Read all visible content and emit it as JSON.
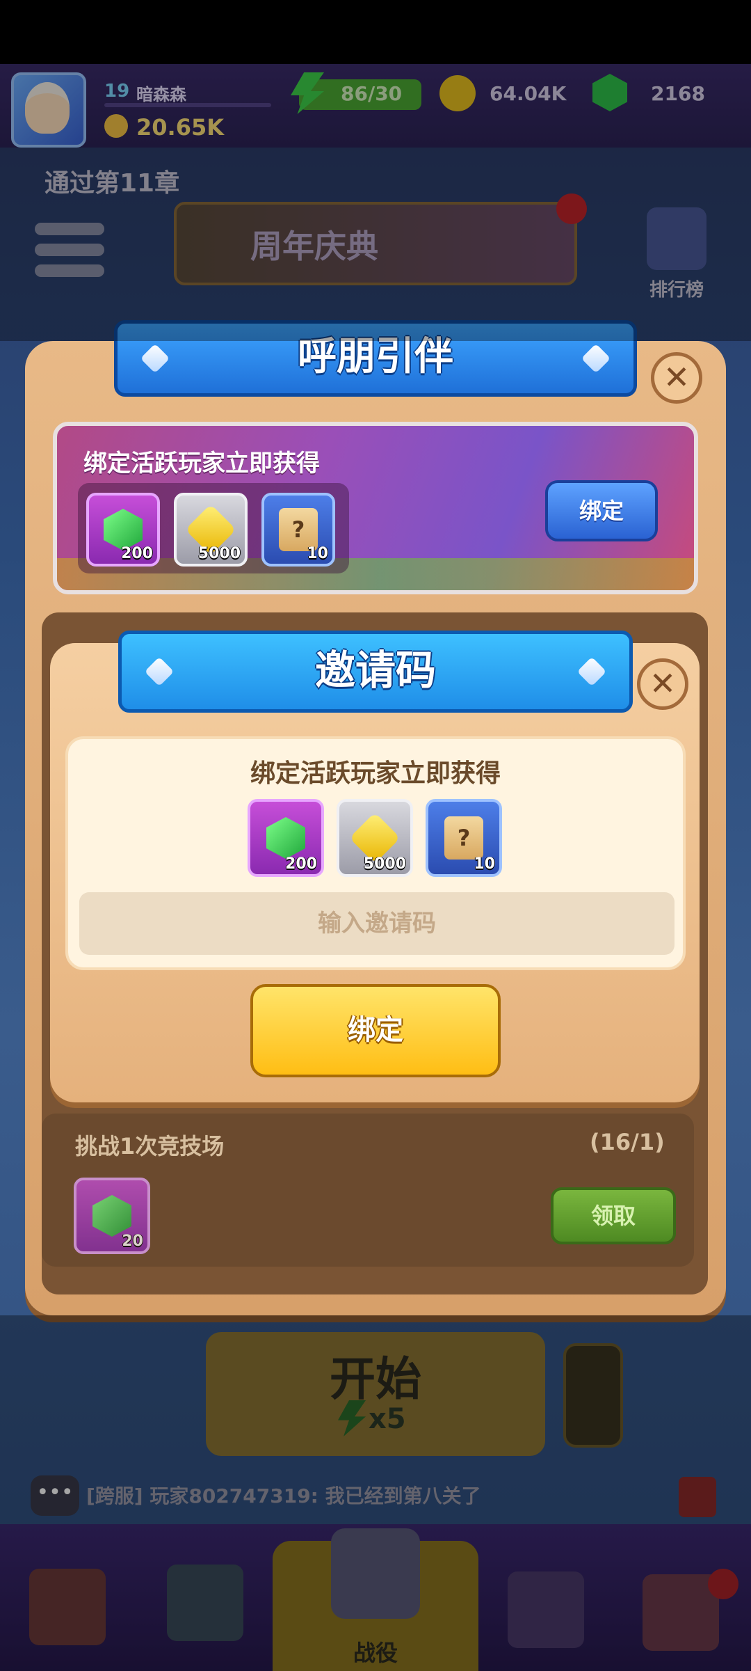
{
  "topbar": {
    "level": "19",
    "player_name": "暗森森",
    "power": "20.65K",
    "energy": "86/30",
    "gold": "64.04K",
    "gems": "2168"
  },
  "scene": {
    "chapter_text": "通过第11章",
    "anniversary": "周年庆典",
    "leaderboard": "排行榜",
    "start_label": "开始",
    "start_cost": "x5",
    "chat_text": "[跨服] 玩家802747319: 我已经到第八关了"
  },
  "modal": {
    "title": "呼朋引伴",
    "banner_text": "绑定活跃玩家立即获得",
    "banner_button": "绑定",
    "rewards": [
      {
        "icon": "gem-icon",
        "qty": "200"
      },
      {
        "icon": "coin-icon",
        "qty": "5000"
      },
      {
        "icon": "scroll-icon",
        "qty": "10"
      }
    ],
    "task_title": "挑战1次竞技场",
    "task_progress": "(16/1)",
    "task_reward_qty": "20",
    "task_button": "领取"
  },
  "invite": {
    "title": "邀请码",
    "subtitle": "绑定活跃玩家立即获得",
    "rewards": [
      {
        "icon": "gem-icon",
        "qty": "200"
      },
      {
        "icon": "coin-icon",
        "qty": "5000"
      },
      {
        "icon": "scroll-icon",
        "qty": "10"
      }
    ],
    "input_placeholder": "输入邀请码",
    "bind_button": "绑定"
  },
  "nav": {
    "battle_label": "战役"
  },
  "colors": {
    "ribbon_blue": "#2a86ee",
    "panel_tan": "#e5b17c",
    "button_yellow": "#ffc81e",
    "button_green": "#5e9a2c"
  }
}
